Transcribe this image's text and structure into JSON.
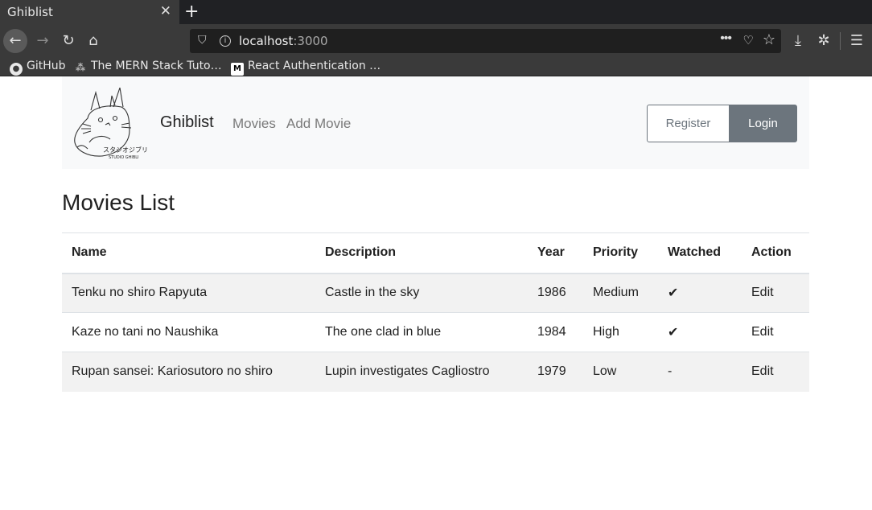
{
  "browser": {
    "tab_title": "Ghiblist",
    "tab_close": "✕",
    "new_tab": "+",
    "url_host": "localhost",
    "url_port": ":3000",
    "bookmarks": [
      {
        "label": "GitHub",
        "icon": "github-icon"
      },
      {
        "label": "The MERN Stack Tuto…",
        "icon": "mern-icon"
      },
      {
        "label": "React Authentication …",
        "icon": "medium-icon"
      }
    ]
  },
  "app": {
    "brand": "Ghiblist",
    "logo_text": "スタジオジブリ作品",
    "logo_subtext": "STUDIO GHIBLI",
    "nav": {
      "movies": "Movies",
      "add_movie": "Add Movie"
    },
    "buttons": {
      "register": "Register",
      "login": "Login"
    },
    "page_title": "Movies List",
    "table": {
      "headers": [
        "Name",
        "Description",
        "Year",
        "Priority",
        "Watched",
        "Action"
      ],
      "rows": [
        {
          "name": "Tenku no shiro Rapyuta",
          "description": "Castle in the sky",
          "year": "1986",
          "priority": "Medium",
          "watched": "✔",
          "action": "Edit"
        },
        {
          "name": "Kaze no tani no Naushika",
          "description": "The one clad in blue",
          "year": "1984",
          "priority": "High",
          "watched": "✔",
          "action": "Edit"
        },
        {
          "name": "Rupan sansei: Kariosutoro no shiro",
          "description": "Lupin investigates Cagliostro",
          "year": "1979",
          "priority": "Low",
          "watched": "-",
          "action": "Edit"
        }
      ]
    }
  },
  "colors": {
    "accent_link": "#1a7bd4",
    "button_secondary": "#6c757d",
    "navbar_bg": "#f8f9fa"
  }
}
